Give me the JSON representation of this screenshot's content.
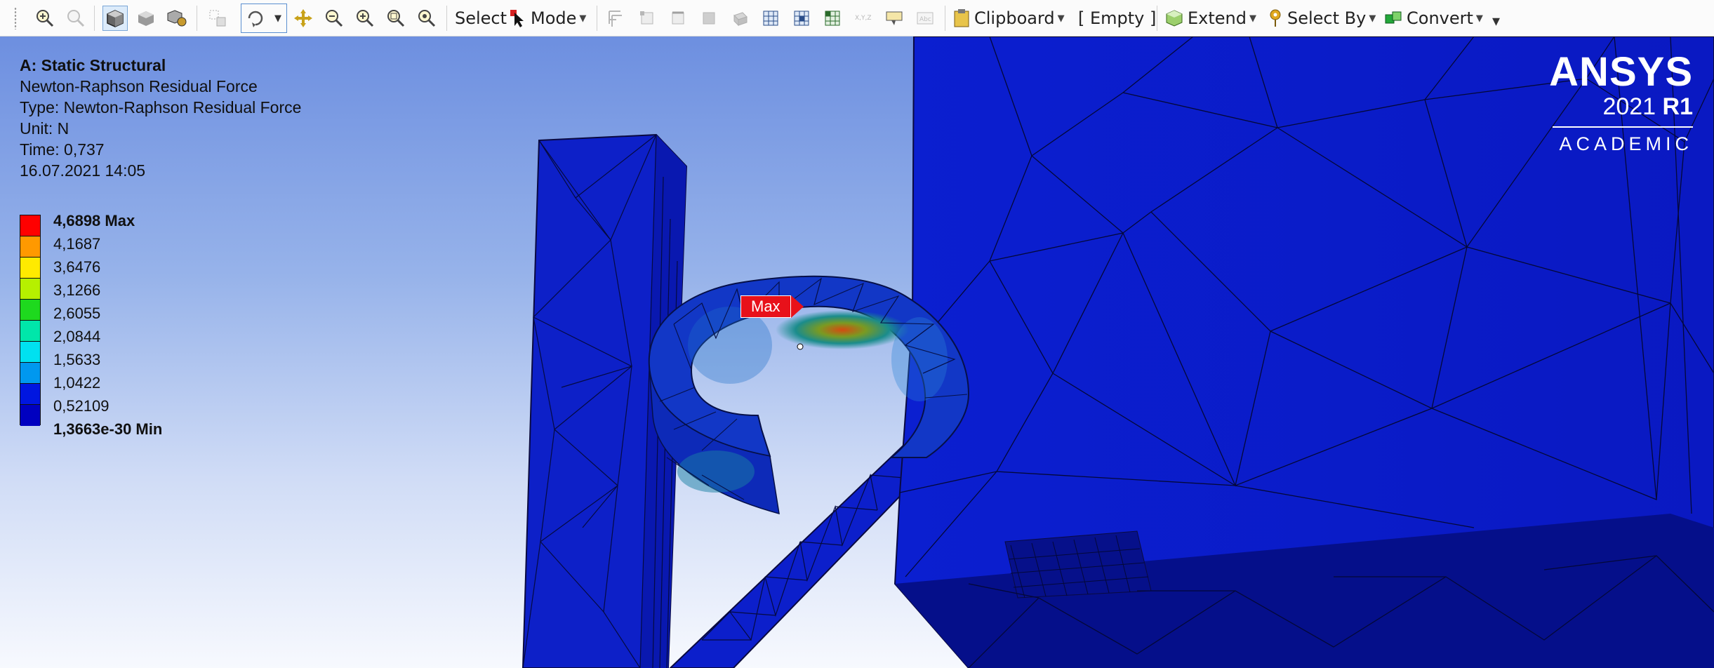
{
  "toolbar": {
    "select_label": "Select",
    "mode_label": "Mode",
    "clipboard_label": "Clipboard",
    "empty_label": "[ Empty ]",
    "extend_label": "Extend",
    "select_by_label": "Select By",
    "convert_label": "Convert",
    "icons": [
      "zoom-to-fit-icon",
      "zoom-icon",
      "shaded-exterior-icon",
      "shaded-icon",
      "wireframe-icon",
      "box-zoom-icon",
      "rotate-icon",
      "pan-icon",
      "zoom-out-icon",
      "zoom-in-icon",
      "box-select-zoom-icon",
      "zoom-fit-icon",
      "select-cursor-icon"
    ]
  },
  "result": {
    "system": "A: Static Structural",
    "name": "Newton-Raphson Residual Force",
    "type": "Type: Newton-Raphson Residual Force",
    "unit": "Unit: N",
    "time": "Time: 0,737",
    "date": "16.07.2021 14:05"
  },
  "legend": {
    "max_label": "4,6898 Max",
    "values": [
      "4,1687",
      "3,6476",
      "3,1266",
      "2,6055",
      "2,0844",
      "1,5633",
      "1,0422",
      "0,52109"
    ],
    "min_label": "1,3663e-30 Min",
    "colors": [
      "#ff0000",
      "#ff9900",
      "#ffea00",
      "#b6f000",
      "#1ed91e",
      "#00e6aa",
      "#00e1f0",
      "#0098ef",
      "#0016e0",
      "#0000c0"
    ]
  },
  "logo": {
    "brand": "ANSYS",
    "version_year": "2021",
    "version_release": "R1",
    "edition": "ACADEMIC"
  },
  "probe": {
    "label": "Max"
  }
}
